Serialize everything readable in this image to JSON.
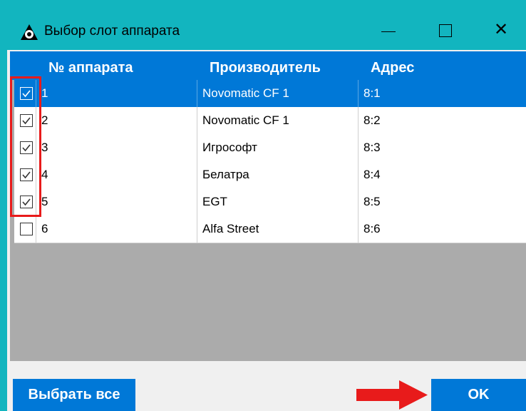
{
  "window": {
    "title": "Выбор слот аппарата",
    "controls": {
      "minimize": "minimize",
      "maximize": "maximize",
      "close": "✕"
    },
    "accent": "#12b5bf"
  },
  "grid": {
    "columns": [
      "№ аппарата",
      "Производитель",
      "Адрес"
    ],
    "rows": [
      {
        "checked": true,
        "number": "1",
        "maker": "Novomatic CF 1",
        "address": "8:1",
        "selected": true
      },
      {
        "checked": true,
        "number": "2",
        "maker": "Novomatic CF 1",
        "address": "8:2",
        "selected": false
      },
      {
        "checked": true,
        "number": "3",
        "maker": "Игрософт",
        "address": "8:3",
        "selected": false
      },
      {
        "checked": true,
        "number": "4",
        "maker": "Белатра",
        "address": "8:4",
        "selected": false
      },
      {
        "checked": true,
        "number": "5",
        "maker": "EGT",
        "address": "8:5",
        "selected": false
      },
      {
        "checked": false,
        "number": "6",
        "maker": "Alfa Street",
        "address": "8:6",
        "selected": false
      }
    ],
    "selection_color": "#0078d7"
  },
  "buttons": {
    "select_all": "Выбрать все",
    "ok": "OK"
  },
  "annotations": {
    "highlight_color": "#e81b1b",
    "arrow_color": "#e81b1b"
  }
}
